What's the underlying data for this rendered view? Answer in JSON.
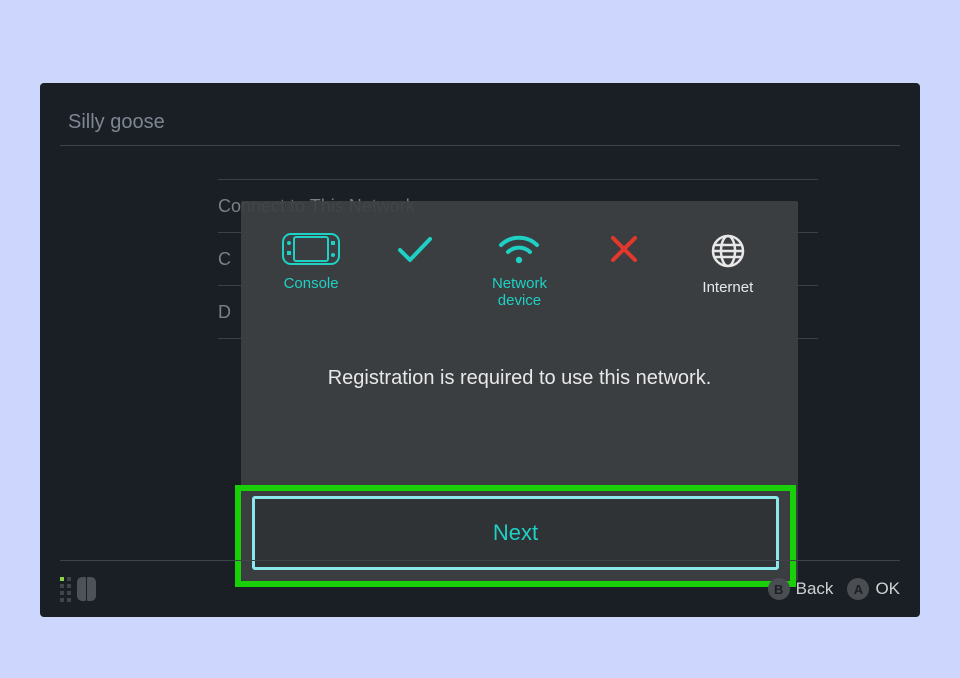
{
  "header": {
    "title": "Silly goose"
  },
  "background_rows": [
    "Connect to This Network",
    "C",
    "D"
  ],
  "dialog": {
    "icons": {
      "console_label": "Console",
      "network_label": "Network device",
      "internet_label": "Internet"
    },
    "message": "Registration is required to use this network.",
    "next_label": "Next"
  },
  "footer": {
    "back_label": "Back",
    "back_key": "B",
    "ok_label": "OK",
    "ok_key": "A"
  }
}
